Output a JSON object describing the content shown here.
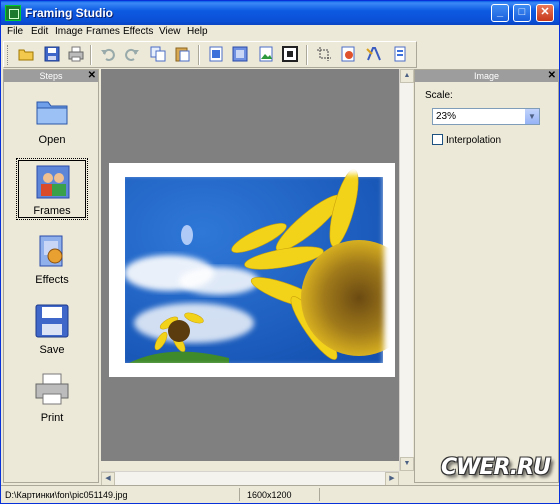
{
  "window": {
    "title": "Framing Studio",
    "minimize_label": "_",
    "maximize_label": "□",
    "close_label": "✕"
  },
  "menu": [
    "File",
    "Edit",
    "Image",
    "Frames",
    "Effects",
    "View",
    "Help"
  ],
  "toolbar": {
    "tools": [
      "open-folder-icon",
      "save-icon",
      "print-icon",
      "undo-icon",
      "redo-icon",
      "copy-icon",
      "paste-icon",
      "image-icon",
      "frame-icon",
      "picture-icon",
      "border-icon",
      "crop-icon",
      "effects-icon",
      "text-icon",
      "properties-icon"
    ]
  },
  "steps_panel": {
    "title": "Steps",
    "close_label": "✕",
    "items": [
      {
        "label": "Open",
        "icon": "folder-icon"
      },
      {
        "label": "Frames",
        "icon": "frames-icon"
      },
      {
        "label": "Effects",
        "icon": "effects-icon"
      },
      {
        "label": "Save",
        "icon": "floppy-disk-icon"
      },
      {
        "label": "Print",
        "icon": "printer-icon"
      }
    ],
    "active_index": 1
  },
  "image_panel": {
    "title": "Image",
    "close_label": "✕",
    "scale_label": "Scale:",
    "scale_value": "23%",
    "interpolation_label": "Interpolation",
    "interpolation_checked": false
  },
  "status": {
    "path": "D:\\Картинки\\fon\\pic051149.jpg",
    "dimensions": "1600x1200"
  },
  "watermark": "CWER.RU",
  "colors": {
    "titlebar": "#0a5ee6",
    "canvas_bg": "#808080",
    "panel_header": "#9d9d9d"
  }
}
